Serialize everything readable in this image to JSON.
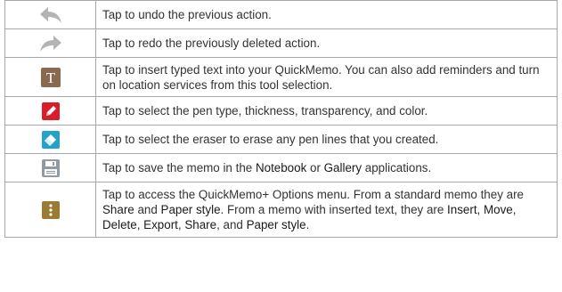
{
  "rows": [
    {
      "icon": "undo-arrow-icon",
      "segments": [
        {
          "t": "Tap to undo the previous action."
        }
      ]
    },
    {
      "icon": "redo-arrow-icon",
      "segments": [
        {
          "t": "Tap to redo the previously deleted action."
        }
      ]
    },
    {
      "icon": "text-tool-icon",
      "segments": [
        {
          "t": "Tap to insert typed text into your QuickMemo. You can also add reminders and turn on location services from this tool selection."
        }
      ]
    },
    {
      "icon": "pen-tool-icon",
      "segments": [
        {
          "t": "Tap to select the pen type, thickness, transparency, and color."
        }
      ]
    },
    {
      "icon": "eraser-tool-icon",
      "segments": [
        {
          "t": "Tap to select the eraser to erase any pen lines that you created."
        }
      ]
    },
    {
      "icon": "save-disk-icon",
      "segments": [
        {
          "t": "Tap to save the memo in the "
        },
        {
          "t": "Notebook",
          "s": 1
        },
        {
          "t": " or "
        },
        {
          "t": "Gallery",
          "s": 1
        },
        {
          "t": " applications."
        }
      ]
    },
    {
      "icon": "options-menu-icon",
      "segments": [
        {
          "t": "Tap to access the QuickMemo+ Options menu. From a standard memo they are "
        },
        {
          "t": "Share",
          "s": 1
        },
        {
          "t": " and "
        },
        {
          "t": "Paper style",
          "s": 1
        },
        {
          "t": ". From a memo with inserted text, they are "
        },
        {
          "t": "Insert",
          "s": 1
        },
        {
          "t": ", "
        },
        {
          "t": "Move",
          "s": 1
        },
        {
          "t": ", "
        },
        {
          "t": "Delete",
          "s": 1
        },
        {
          "t": ", "
        },
        {
          "t": "Export",
          "s": 1
        },
        {
          "t": ", "
        },
        {
          "t": "Share",
          "s": 1
        },
        {
          "t": ", and "
        },
        {
          "t": "Paper style",
          "s": 1
        },
        {
          "t": "."
        }
      ]
    }
  ],
  "colors": {
    "arrow_gray": "#b4b4b4",
    "tile_brown": "#8a6a4e",
    "pen_red": "#d81e2a",
    "eraser_blue": "#23a3c7",
    "disk_gray": "#8f9aa3",
    "options_olive": "#9b7a33"
  }
}
